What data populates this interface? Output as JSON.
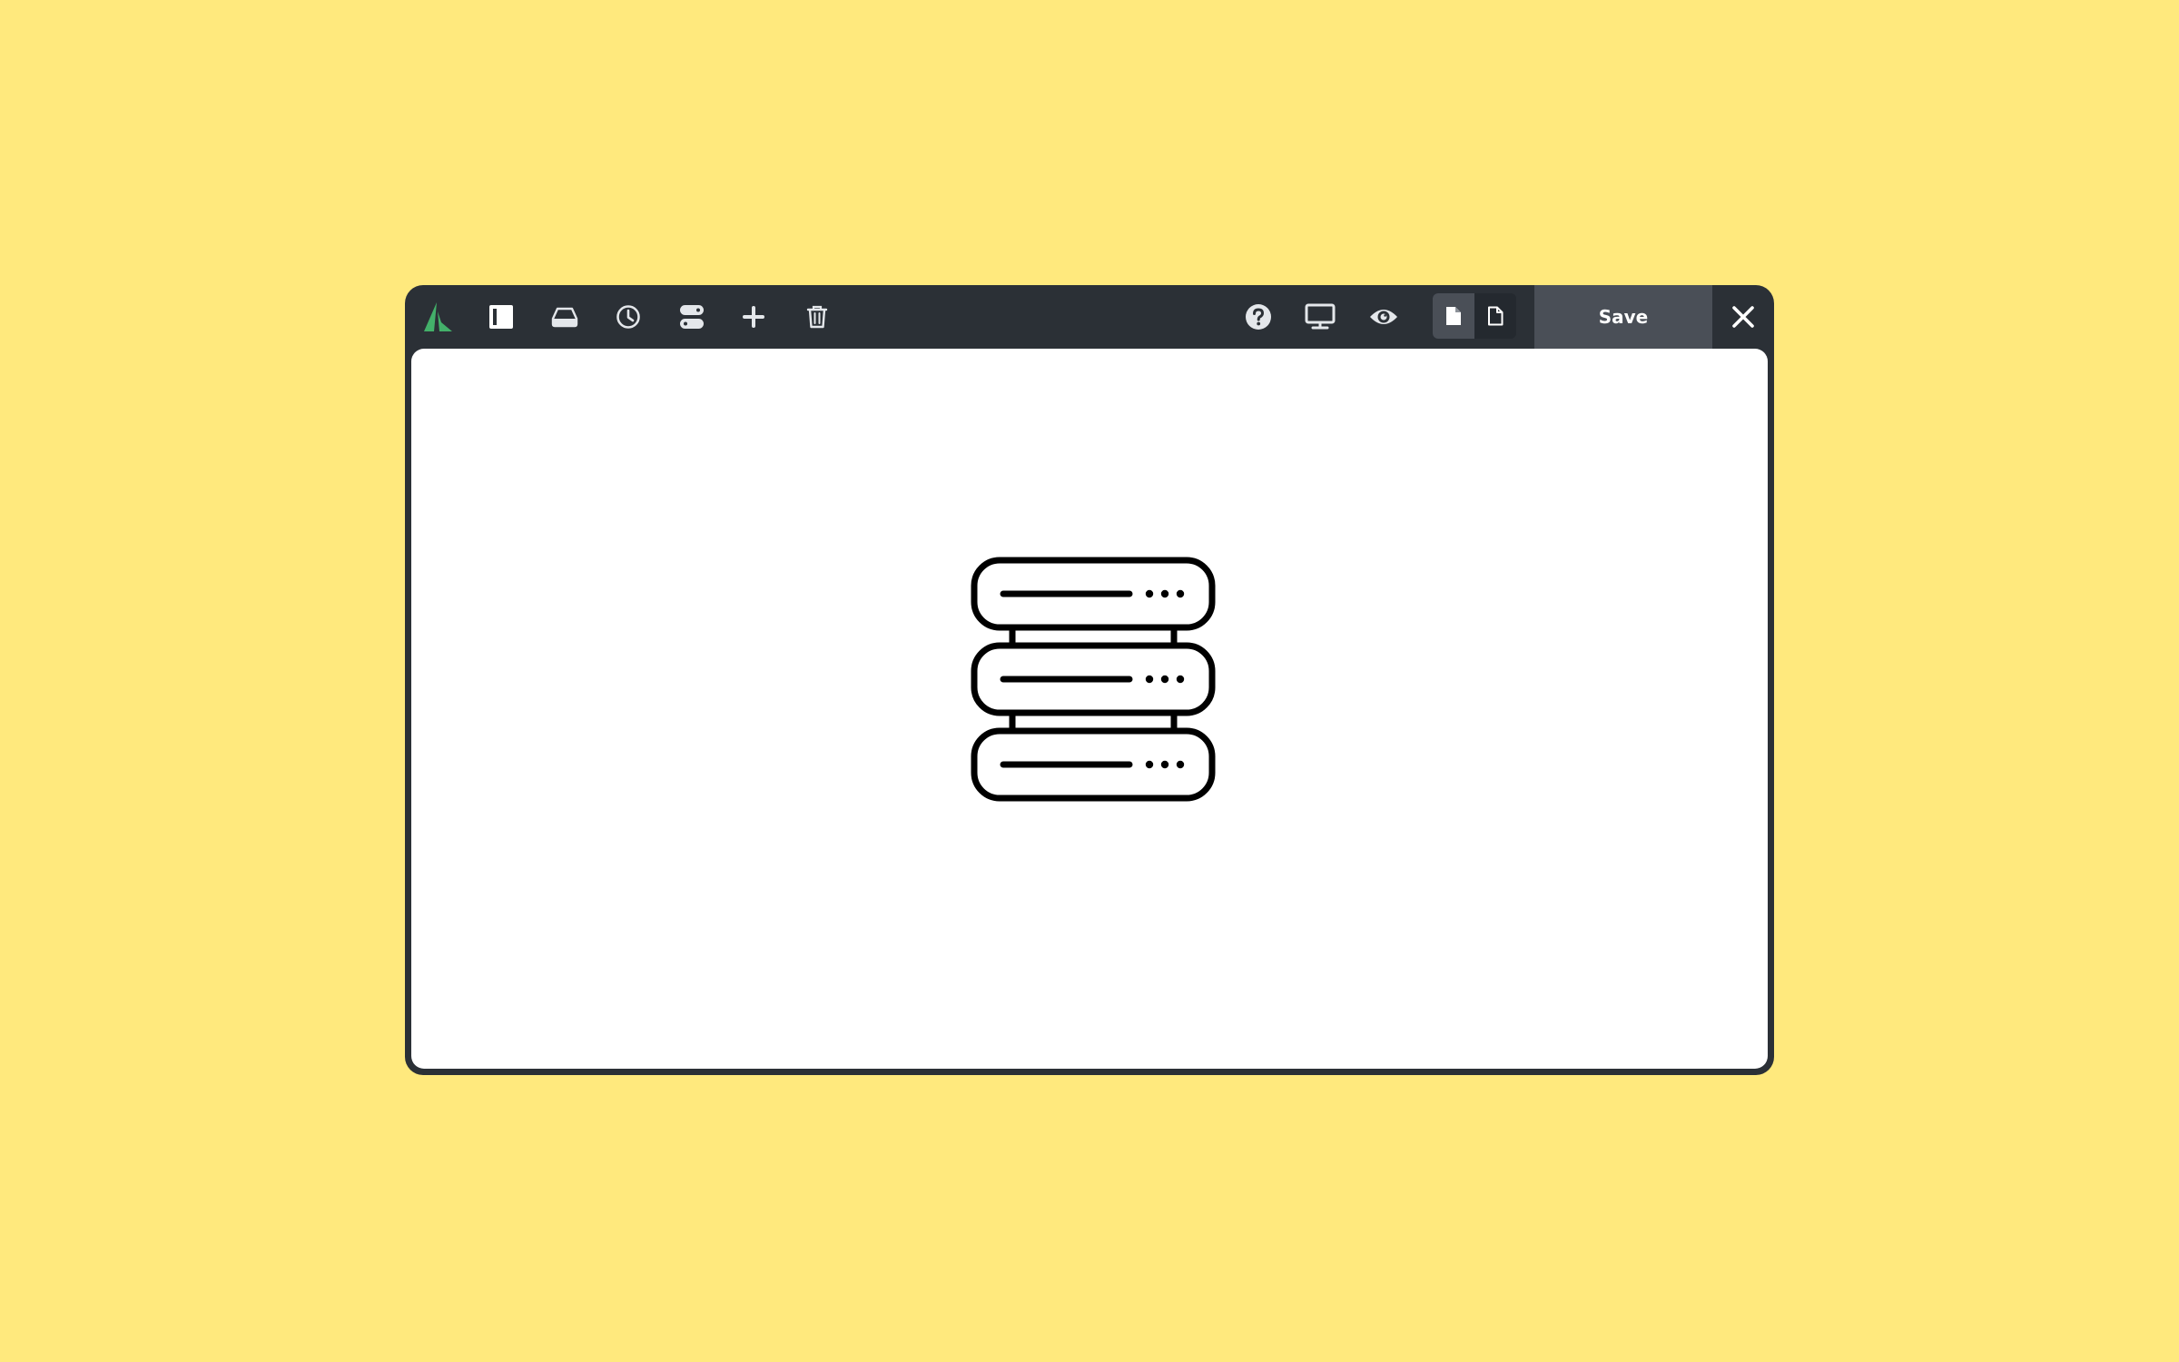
{
  "colors": {
    "background": "#FFE97D",
    "toolbar": "#2B3036",
    "toolbar_active": "#4A4F57",
    "icon": "#E4E7EB",
    "brand_green": "#43B06A",
    "canvas": "#FFFFFF"
  },
  "toolbar": {
    "left_icons": [
      "logo-icon",
      "sidebar-toggle-icon",
      "drive-icon",
      "history-icon",
      "structure-icon",
      "add-icon",
      "trash-icon"
    ],
    "right_icons": [
      "help-icon",
      "desktop-preview-icon",
      "eye-icon"
    ],
    "view_toggle": {
      "options": [
        "page-solid-icon",
        "page-outline-icon"
      ],
      "selected": 0
    },
    "save_label": "Save",
    "close_icon": "close-icon"
  },
  "canvas": {
    "illustration_icon": "server-stack-icon"
  }
}
